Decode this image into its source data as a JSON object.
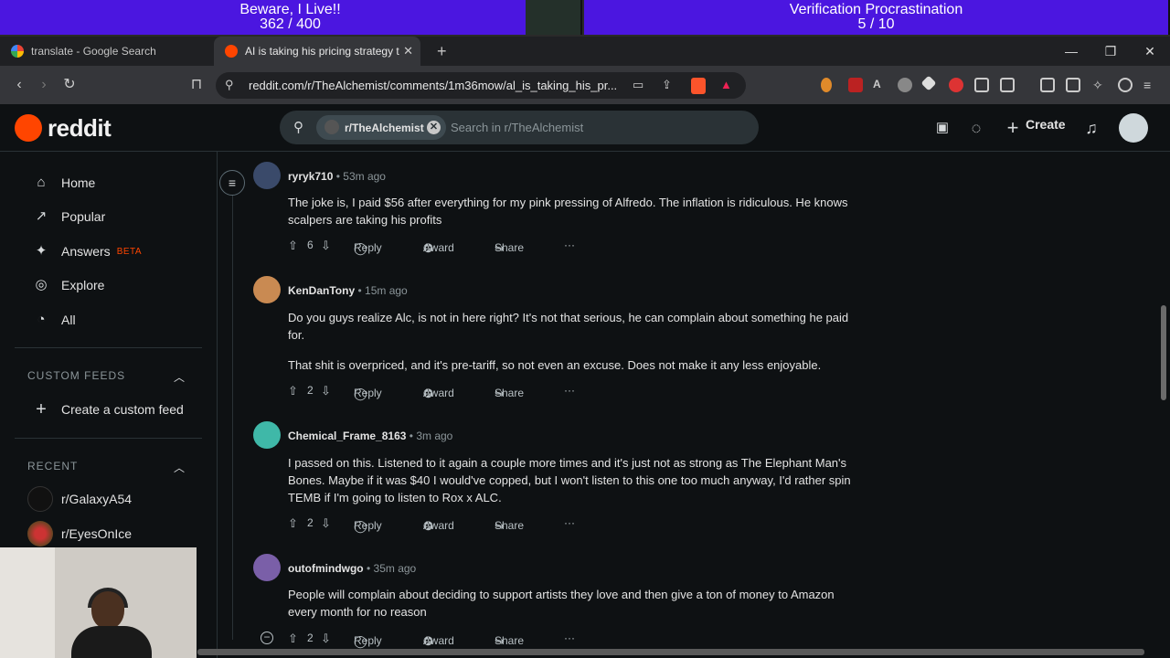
{
  "progress_bars": [
    {
      "title": "Beware, I Live!!",
      "progress": "362 / 400",
      "fraction": 0.905
    },
    {
      "title": "Verification Procrastination",
      "progress": "5 / 10",
      "fraction": 1.0
    }
  ],
  "browser": {
    "tabs": [
      {
        "label": "translate - Google Search",
        "icon": "google-icon"
      },
      {
        "label": "AI is taking his pricing strategy t",
        "icon": "reddit-icon"
      }
    ],
    "new_tab_icon": "+",
    "url": "reddit.com/r/TheAlchemist/comments/1m36mow/al_is_taking_his_pr..."
  },
  "header": {
    "logo_text": "reddit",
    "search_chip": "r/TheAlchemist",
    "search_placeholder": "Search in r/TheAlchemist",
    "create_label": "Create"
  },
  "sidebar": {
    "nav": [
      {
        "label": "Home",
        "icon": "⌂"
      },
      {
        "label": "Popular",
        "icon": "↗"
      },
      {
        "label": "Answers",
        "icon": "✦",
        "badge": "BETA"
      },
      {
        "label": "Explore",
        "icon": "◎"
      },
      {
        "label": "All",
        "icon": "◔"
      }
    ],
    "custom_feeds_heading": "CUSTOM FEEDS",
    "create_feed_label": "Create a custom feed",
    "recent_heading": "RECENT",
    "recent": [
      {
        "label": "r/GalaxyA54"
      },
      {
        "label": "r/EyesOnIce"
      }
    ]
  },
  "comments": [
    {
      "user": "ryryk710",
      "time": "53m ago",
      "body": [
        "The joke is, I paid $56 after everything for my pink pressing of Alfredo. The inflation is ridiculous. He knows scalpers are taking his profits"
      ],
      "votes": "6",
      "avatar_color": "#3a4a6a"
    },
    {
      "user": "KenDanTony",
      "time": "15m ago",
      "body": [
        "Do you guys realize Alc, is not in here right? It's not that serious, he can complain about something he paid for.",
        "That shit is overpriced, and it's pre-tariff, so not even an excuse. Does not make it any less enjoyable."
      ],
      "votes": "2",
      "avatar_color": "#c98a52"
    },
    {
      "user": "Chemical_Frame_8163",
      "time": "3m ago",
      "body": [
        "I passed on this. Listened to it again a couple more times and it's just not as strong as The Elephant Man's Bones. Maybe if it was $40 I would've copped, but I won't listen to this one too much anyway, I'd rather spin TEMB if I'm going to listen to Rox x ALC."
      ],
      "votes": "2",
      "avatar_color": "#3fb8a8"
    },
    {
      "user": "outofmindwgo",
      "time": "35m ago",
      "body": [
        "People will complain about deciding to support artists they love and then give a ton of money to Amazon every month for no reason"
      ],
      "votes": "2",
      "avatar_color": "#7a5fa8"
    }
  ],
  "actions": {
    "reply": "Reply",
    "award": "Award",
    "share": "Share",
    "more": "···"
  },
  "separator": "•"
}
